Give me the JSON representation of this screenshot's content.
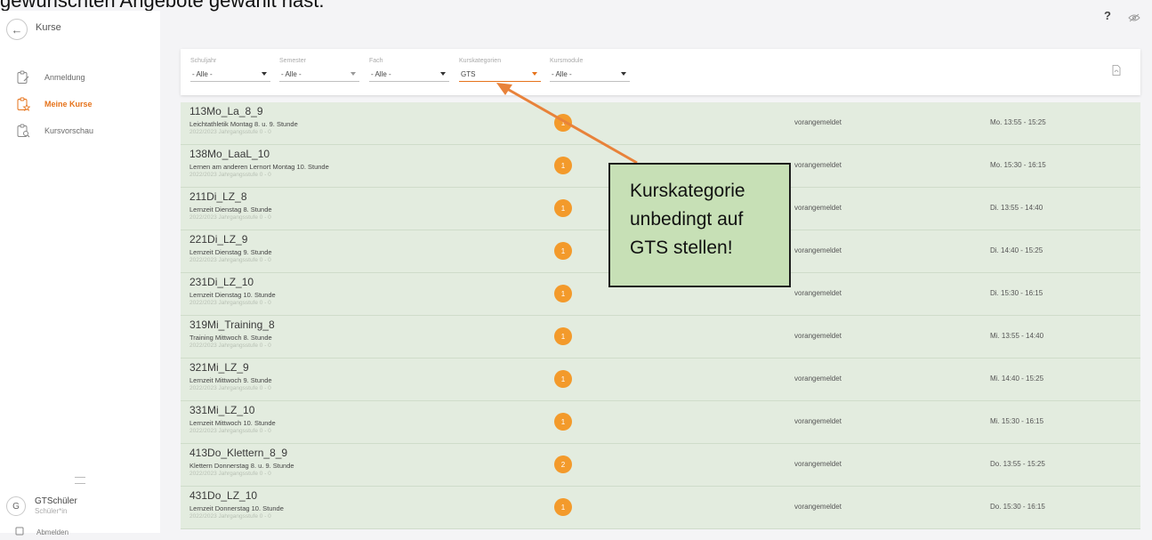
{
  "doc": {
    "top_text": "gewünschten Angebote gewählt hast."
  },
  "app": {
    "title": "Kurse"
  },
  "sidebar": {
    "items": [
      {
        "label": "Anmeldung",
        "icon": "clipboard-edit-icon",
        "active": false
      },
      {
        "label": "Meine Kurse",
        "icon": "clipboard-star-icon",
        "active": true
      },
      {
        "label": "Kursvorschau",
        "icon": "clipboard-search-icon",
        "active": false
      }
    ],
    "user": {
      "initial": "G",
      "name": "GTSchüler",
      "role": "Schüler*in"
    },
    "logout_label": "Abmelden"
  },
  "topbar": {
    "help": "?"
  },
  "filters": [
    {
      "label": "Schuljahr",
      "value": "- Alle -"
    },
    {
      "label": "Semester",
      "value": "- Alle -"
    },
    {
      "label": "Fach",
      "value": "- Alle -"
    },
    {
      "label": "Kurskategorien",
      "value": "GTS"
    },
    {
      "label": "Kursmodule",
      "value": "- Alle -"
    }
  ],
  "courses": [
    {
      "code": "113Mo_La_8_9",
      "desc": "Leichtathletik Montag 8. u. 9. Stunde",
      "meta": "2022/2023 Jahrgangsstufe 0 - 0",
      "badge": "1",
      "status": "vorangemeldet",
      "time": "Mo. 13:55 - 15:25"
    },
    {
      "code": "138Mo_LaaL_10",
      "desc": "Lernen am anderen Lernort Montag 10. Stunde",
      "meta": "2022/2023 Jahrgangsstufe 0 - 0",
      "badge": "1",
      "status": "vorangemeldet",
      "time": "Mo. 15:30 - 16:15"
    },
    {
      "code": "211Di_LZ_8",
      "desc": "Lernzeit Dienstag 8. Stunde",
      "meta": "2022/2023 Jahrgangsstufe 0 - 0",
      "badge": "1",
      "status": "vorangemeldet",
      "time": "Di. 13:55 - 14:40"
    },
    {
      "code": "221Di_LZ_9",
      "desc": "Lernzeit Dienstag 9. Stunde",
      "meta": "2022/2023 Jahrgangsstufe 0 - 0",
      "badge": "1",
      "status": "vorangemeldet",
      "time": "Di. 14:40 - 15:25"
    },
    {
      "code": "231Di_LZ_10",
      "desc": "Lernzeit Dienstag 10. Stunde",
      "meta": "2022/2023 Jahrgangsstufe 0 - 0",
      "badge": "1",
      "status": "vorangemeldet",
      "time": "Di. 15:30 - 16:15"
    },
    {
      "code": "319Mi_Training_8",
      "desc": "Training Mittwoch 8. Stunde",
      "meta": "2022/2023 Jahrgangsstufe 0 - 0",
      "badge": "1",
      "status": "vorangemeldet",
      "time": "Mi. 13:55 - 14:40"
    },
    {
      "code": "321Mi_LZ_9",
      "desc": "Lernzeit Mittwoch 9. Stunde",
      "meta": "2022/2023 Jahrgangsstufe 0 - 0",
      "badge": "1",
      "status": "vorangemeldet",
      "time": "Mi. 14:40 - 15:25"
    },
    {
      "code": "331Mi_LZ_10",
      "desc": "Lernzeit Mittwoch 10. Stunde",
      "meta": "2022/2023 Jahrgangsstufe 0 - 0",
      "badge": "1",
      "status": "vorangemeldet",
      "time": "Mi. 15:30 - 16:15"
    },
    {
      "code": "413Do_Klettern_8_9",
      "desc": "Klettern Donnerstag 8. u. 9. Stunde",
      "meta": "2022/2023 Jahrgangsstufe 0 - 0",
      "badge": "2",
      "status": "vorangemeldet",
      "time": "Do. 13:55 - 15:25"
    },
    {
      "code": "431Do_LZ_10",
      "desc": "Lernzeit Donnerstag 10. Stunde",
      "meta": "2022/2023 Jahrgangsstufe 0 - 0",
      "badge": "1",
      "status": "vorangemeldet",
      "time": "Do. 15:30 - 16:15"
    }
  ],
  "callout": {
    "lines": [
      "Kurskategorie",
      "unbedingt auf",
      "GTS stellen!"
    ]
  },
  "colors": {
    "accent": "#e6731b",
    "badge": "#f39a2b",
    "row_bg": "#e3ecdf",
    "callout_bg": "#c7e0b6",
    "arrow": "#e8823a"
  }
}
